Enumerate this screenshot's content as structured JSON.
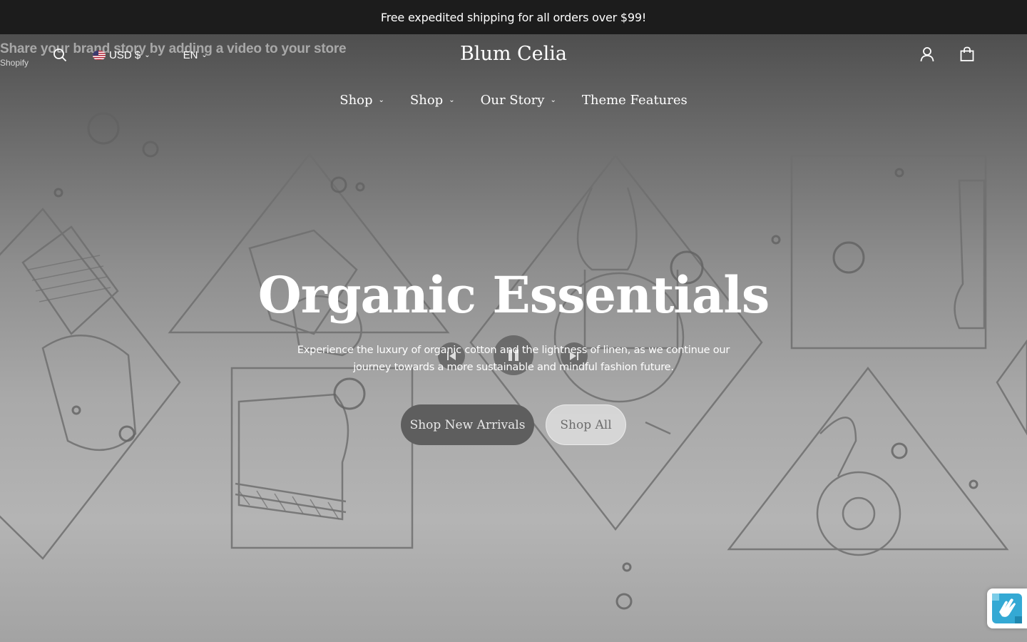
{
  "announcement": {
    "text": "Free expedited shipping for all orders over $99!"
  },
  "video_overlay": {
    "title": "Share your brand story by adding a video to your store",
    "source": "Shopify"
  },
  "header": {
    "currency": "USD $",
    "language": "EN",
    "logo": "Blum Celia",
    "icons": [
      "search-icon",
      "us-flag-icon",
      "account-icon",
      "cart-icon"
    ]
  },
  "nav": {
    "items": [
      {
        "label": "Shop",
        "has_dropdown": true
      },
      {
        "label": "Shop",
        "has_dropdown": true
      },
      {
        "label": "Our Story",
        "has_dropdown": true
      },
      {
        "label": "Theme Features",
        "has_dropdown": false
      }
    ]
  },
  "hero": {
    "title": "Organic Essentials",
    "subtitle": "Experience the luxury of organic cotton and the lightness of linen, as we continue our journey towards a more sustainable and mindful fashion future.",
    "primary_button": "Shop New Arrivals",
    "secondary_button": "Shop All"
  },
  "colors": {
    "announcement_bg": "#1c1c1c",
    "primary_button_bg": "#5e5e5e",
    "text": "#ffffff"
  }
}
